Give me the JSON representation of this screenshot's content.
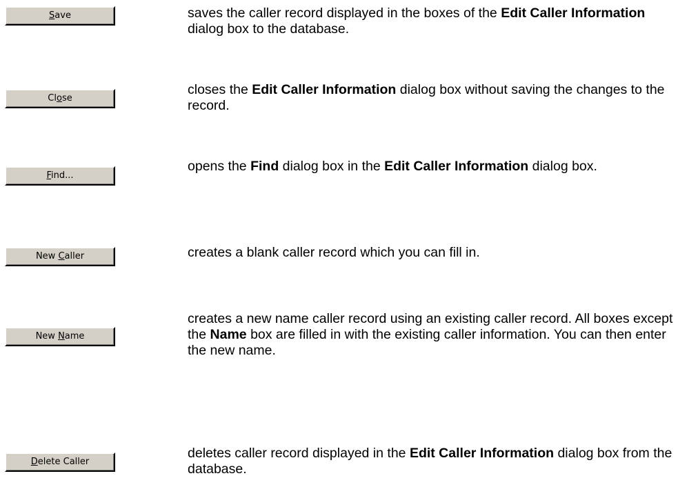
{
  "entries": [
    {
      "button": {
        "pre": "",
        "key": "S",
        "post": "ave"
      },
      "desc": [
        {
          "t": "saves the caller record displayed in the boxes of the ",
          "b": false
        },
        {
          "t": "Edit Caller Information",
          "b": true
        },
        {
          "t": " dialog box to the database.",
          "b": false
        }
      ]
    },
    {
      "button": {
        "pre": "Cl",
        "key": "o",
        "post": "se"
      },
      "desc": [
        {
          "t": "closes the ",
          "b": false
        },
        {
          "t": "Edit Caller Information",
          "b": true
        },
        {
          "t": " dialog box without saving the changes to the record.",
          "b": false
        }
      ]
    },
    {
      "button": {
        "pre": "",
        "key": "F",
        "post": "ind..."
      },
      "desc": [
        {
          "t": "opens the ",
          "b": false
        },
        {
          "t": "Find",
          "b": true
        },
        {
          "t": " dialog box in the ",
          "b": false
        },
        {
          "t": "Edit Caller Information",
          "b": true
        },
        {
          "t": " dialog box.",
          "b": false
        }
      ]
    },
    {
      "button": {
        "pre": "New ",
        "key": "C",
        "post": "aller"
      },
      "desc": [
        {
          "t": "creates a blank caller record which you can fill in.",
          "b": false
        }
      ]
    },
    {
      "button": {
        "pre": "New ",
        "key": "N",
        "post": "ame"
      },
      "desc": [
        {
          "t": "creates a new name caller record using an existing caller record. All boxes except the ",
          "b": false
        },
        {
          "t": "Name",
          "b": true
        },
        {
          "t": " box are filled in with the existing caller information. You can then enter the new name.",
          "b": false
        }
      ]
    },
    {
      "button": {
        "pre": "",
        "key": "D",
        "post": "elete Caller"
      },
      "desc": [
        {
          "t": "deletes caller record displayed in the ",
          "b": false
        },
        {
          "t": "Edit Caller Information",
          "b": true
        },
        {
          "t": " dialog box from the database.",
          "b": false
        }
      ]
    }
  ]
}
